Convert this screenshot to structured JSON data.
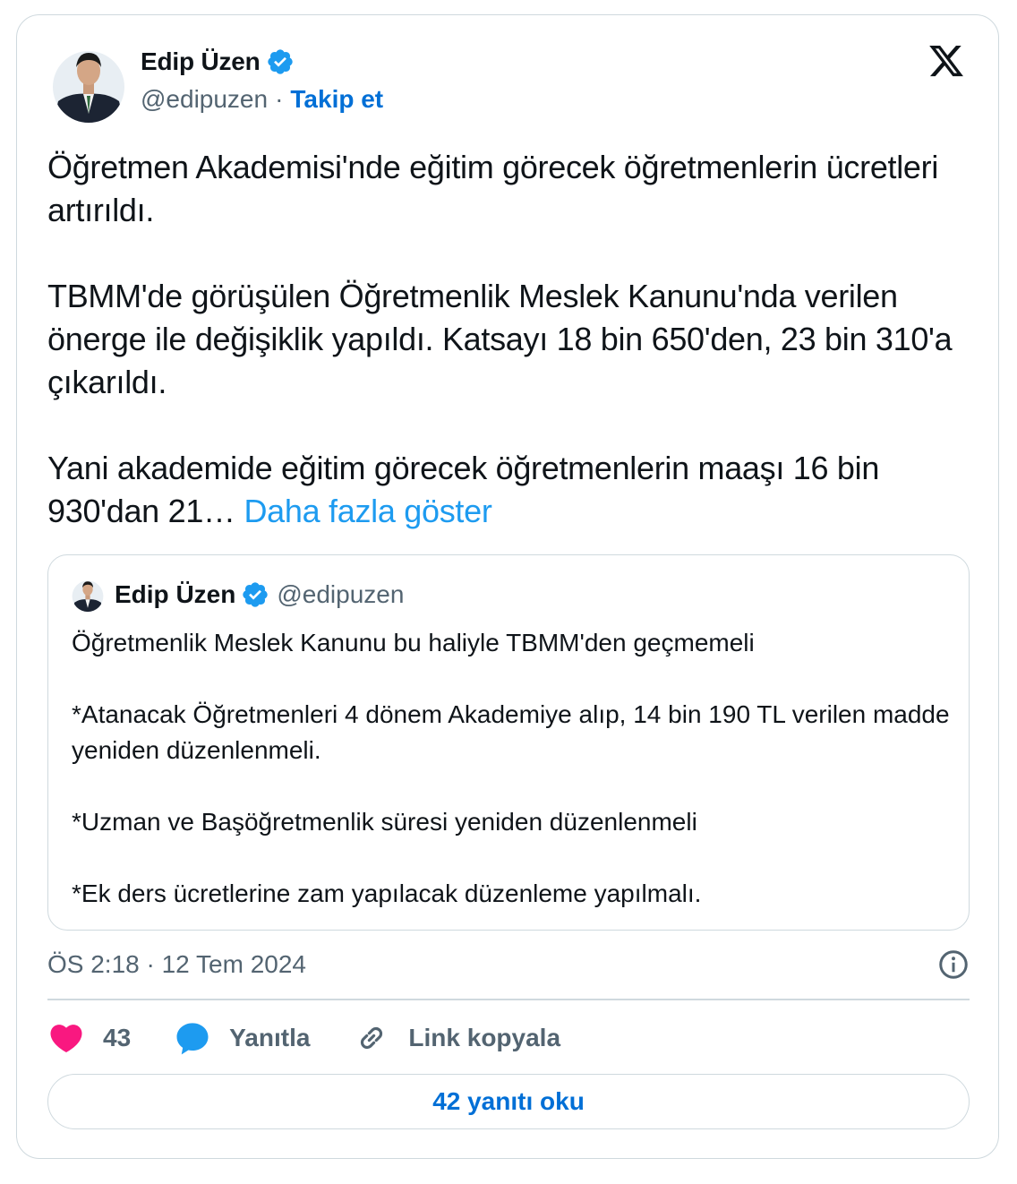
{
  "author": {
    "name": "Edip Üzen",
    "handle": "@edipuzen",
    "separator": "·",
    "follow_label": "Takip et"
  },
  "tweet": {
    "text": "Öğretmen Akademisi'nde eğitim görecek öğretmenlerin ücretleri artırıldı.\n\nTBMM'de görüşülen Öğretmenlik Meslek Kanunu'nda verilen önerge ile değişiklik yapıldı. Katsayı 18 bin 650'den, 23 bin 310'a çıkarıldı.\n\nYani akademide eğitim görecek öğretmenlerin maaşı 16 bin 930'dan 21… ",
    "show_more_label": "Daha fazla göster"
  },
  "quote": {
    "name": "Edip Üzen",
    "handle": "@edipuzen",
    "text": "Öğretmenlik Meslek Kanunu bu haliyle TBMM'den geçmemeli\n\n*Atanacak Öğretmenleri 4 dönem Akademiye alıp, 14 bin 190 TL verilen madde yeniden düzenlenmeli.\n\n*Uzman ve Başöğretmenlik süresi yeniden düzenlenmeli\n\n*Ek ders ücretlerine zam yapılacak düzenleme yapılmalı."
  },
  "timestamp": "ÖS 2:18 · 12 Tem 2024",
  "actions": {
    "likes": "43",
    "reply_label": "Yanıtla",
    "copy_link_label": "Link kopyala"
  },
  "read_replies_label": "42 yanıtı oku",
  "icons": {
    "verified": "verified-badge-icon",
    "logo": "x-logo-icon",
    "info": "info-icon",
    "like": "heart-icon",
    "reply": "speech-bubble-icon",
    "link": "link-icon"
  },
  "colors": {
    "accent": "#1d9bf0",
    "link_blue": "#006fd6",
    "like": "#f91880",
    "text": "#0f1419",
    "secondary": "#536471",
    "border": "#cfd9de"
  }
}
